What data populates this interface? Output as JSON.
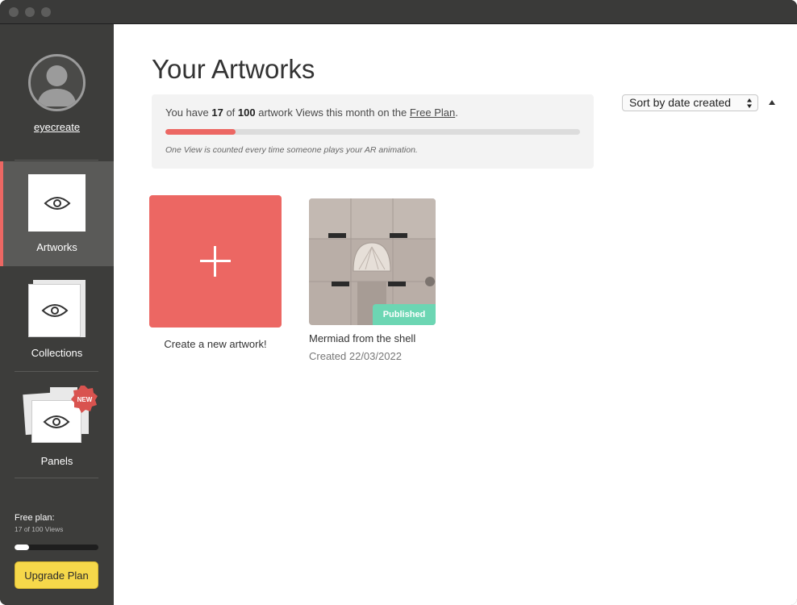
{
  "sidebar": {
    "username": "eyecreate",
    "nav": [
      {
        "label": "Artworks",
        "icon": "eye-icon",
        "active": true
      },
      {
        "label": "Collections",
        "icon": "eye-icon",
        "active": false
      },
      {
        "label": "Panels",
        "icon": "eye-icon",
        "active": false,
        "badge": "NEW"
      }
    ],
    "plan_label": "Free plan:",
    "plan_views": "17 of 100 Views",
    "plan_progress": 0.17,
    "upgrade_label": "Upgrade Plan"
  },
  "main": {
    "title": "Your Artworks",
    "usage": {
      "prefix": "You have ",
      "used": "17",
      "of": " of ",
      "limit": "100",
      "suffix": " artwork Views this month on the ",
      "plan_link": "Free Plan",
      "period": ".",
      "progress": 0.17,
      "note": "One View is counted every time someone plays your AR animation."
    },
    "sort": {
      "selected": "Sort by date created"
    },
    "create_label": "Create a new artwork!",
    "artworks": [
      {
        "title": "Mermiad from the shell",
        "created": "Created 22/03/2022",
        "status": "Published"
      }
    ]
  },
  "colors": {
    "accent": "#ec6763",
    "published": "#6cd6b3",
    "upgrade": "#f6d84a",
    "sidebar": "#3d3d3b"
  }
}
